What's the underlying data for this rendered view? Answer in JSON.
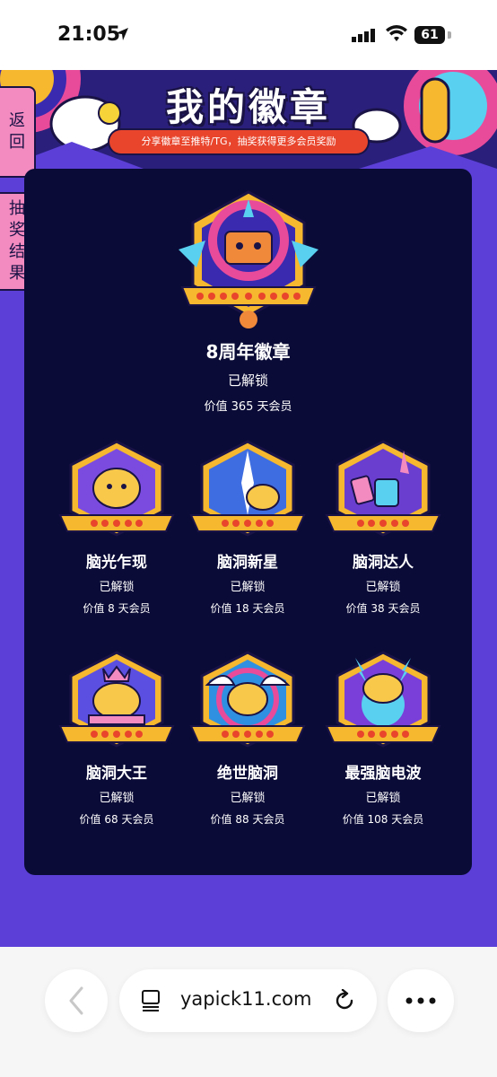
{
  "status_bar": {
    "time": "21:05",
    "battery": "61"
  },
  "header": {
    "title": "我的徽章",
    "subtitle": "分享徽章至推特/TG，抽奖获得更多会员奖励"
  },
  "side_buttons": {
    "back_label": "返回",
    "lottery_label": "抽奖结果"
  },
  "main_badge": {
    "name": "8周年徽章",
    "status": "已解锁",
    "value": "价值 365 天会员"
  },
  "badges": [
    {
      "name": "脑光乍现",
      "status": "已解锁",
      "value": "价值 8 天会员",
      "color": "#7b4be0"
    },
    {
      "name": "脑洞新星",
      "status": "已解锁",
      "value": "价值 18 天会员",
      "color": "#3d6de0"
    },
    {
      "name": "脑洞达人",
      "status": "已解锁",
      "value": "价值 38 天会员",
      "color": "#6a3fd0"
    },
    {
      "name": "脑洞大王",
      "status": "已解锁",
      "value": "价值 68 天会员",
      "color": "#5a4fe0"
    },
    {
      "name": "绝世脑洞",
      "status": "已解锁",
      "value": "价值 88 天会员",
      "color": "#2f8fe0"
    },
    {
      "name": "最强脑电波",
      "status": "已解锁",
      "value": "价值 108 天会员",
      "color": "#7a3fd8"
    }
  ],
  "browser": {
    "url": "yapick11.com"
  },
  "colors": {
    "page_bg": "#5b3fd6",
    "panel_bg": "#0b0b38",
    "accent_pink": "#f38ac0",
    "accent_red": "#e8452c",
    "gold": "#f5b82e"
  },
  "icons": [
    "location-arrow-icon",
    "signal-icon",
    "wifi-icon",
    "battery-icon",
    "back-chevron-icon",
    "page-icon",
    "reload-icon",
    "more-icon"
  ]
}
